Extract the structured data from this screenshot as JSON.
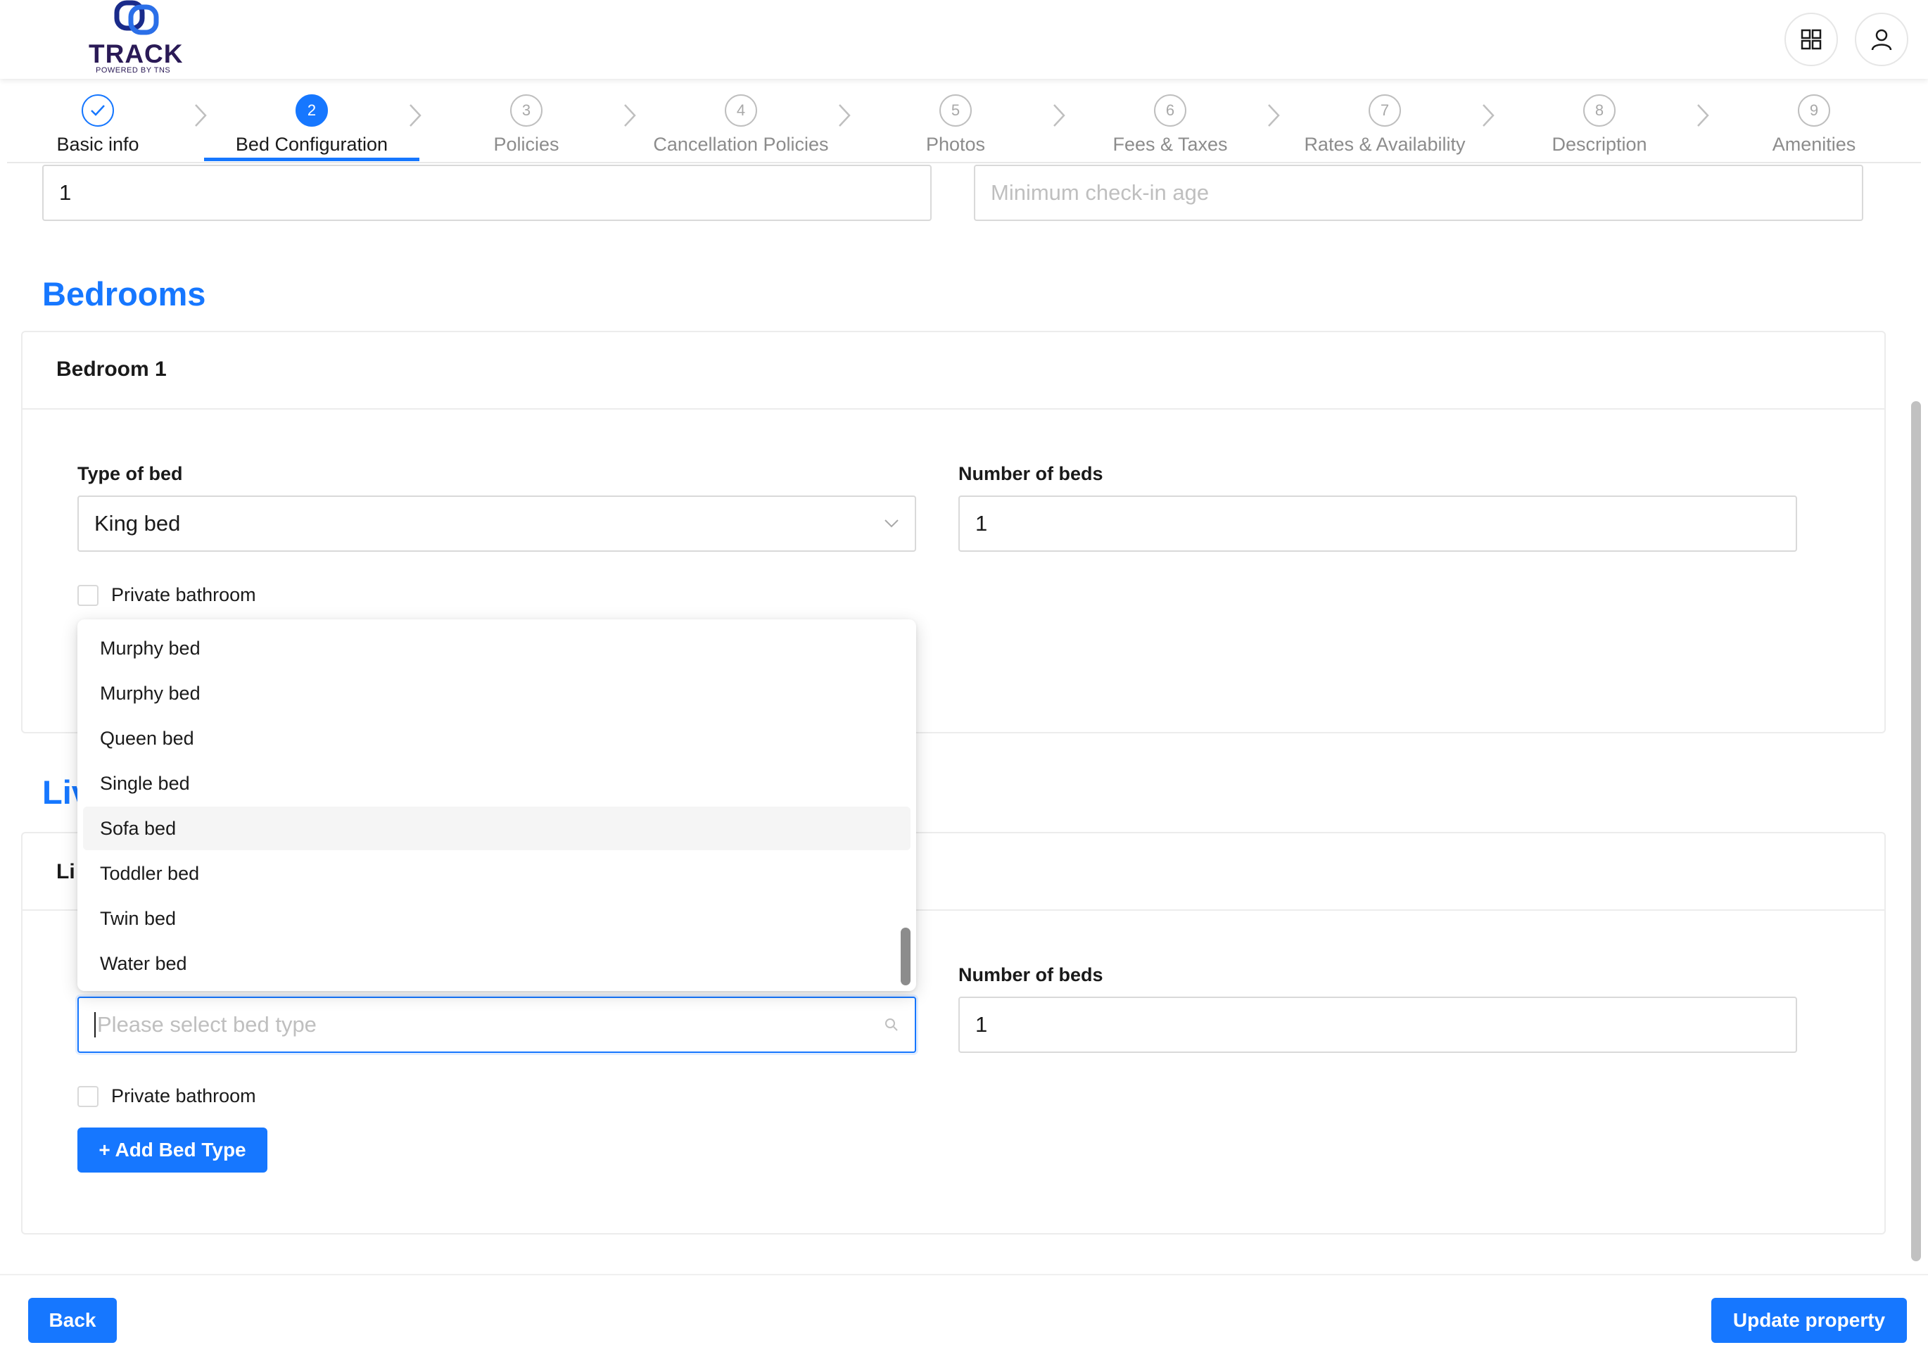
{
  "header": {
    "logo_text": "TRACK",
    "logo_subtext": "POWERED BY TNS",
    "apps_icon": "grid-icon",
    "profile_icon": "user-icon"
  },
  "steps": [
    {
      "number": "1",
      "label": "Basic info",
      "state": "done"
    },
    {
      "number": "2",
      "label": "Bed Configuration",
      "state": "active"
    },
    {
      "number": "3",
      "label": "Policies",
      "state": "pending"
    },
    {
      "number": "4",
      "label": "Cancellation Policies",
      "state": "pending"
    },
    {
      "number": "5",
      "label": "Photos",
      "state": "pending"
    },
    {
      "number": "6",
      "label": "Fees & Taxes",
      "state": "pending"
    },
    {
      "number": "7",
      "label": "Rates & Availability",
      "state": "pending"
    },
    {
      "number": "8",
      "label": "Description",
      "state": "pending"
    },
    {
      "number": "9",
      "label": "Amenities",
      "state": "pending"
    }
  ],
  "top_fields": {
    "left_value": "1",
    "min_age_placeholder": "Minimum check-in age"
  },
  "bedrooms": {
    "title": "Bedrooms",
    "card_title": "Bedroom 1",
    "type_label": "Type of bed",
    "type_value": "King bed",
    "count_label": "Number of beds",
    "count_value": "1",
    "private_bathroom": "Private bathroom"
  },
  "living": {
    "title_partial": "Liv",
    "card_title_partial": "Li",
    "type_placeholder": "Please select bed type",
    "count_label": "Number of beds",
    "count_value": "1",
    "private_bathroom": "Private bathroom",
    "add_button": "+ Add Bed Type"
  },
  "dropdown": {
    "options": [
      "Murphy bed",
      "Murphy bed",
      "Queen bed",
      "Single bed",
      "Sofa bed",
      "Toddler bed",
      "Twin bed",
      "Water bed"
    ],
    "hovered": "Sofa bed"
  },
  "footer": {
    "back": "Back",
    "update": "Update property"
  },
  "colors": {
    "primary": "#1677ff",
    "brand": "#2a1a56"
  }
}
